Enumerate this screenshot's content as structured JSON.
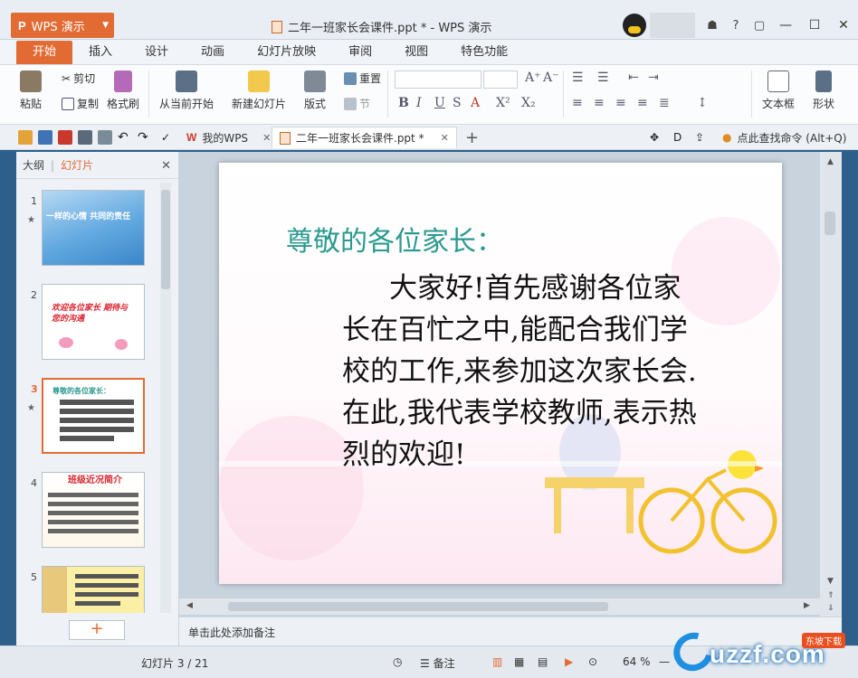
{
  "app": {
    "button_label": "WPS 演示",
    "window_title": "二年一班家长会课件.ppt * - WPS 演示"
  },
  "tabs": [
    "开始",
    "插入",
    "设计",
    "动画",
    "幻灯片放映",
    "审阅",
    "视图",
    "特色功能"
  ],
  "ribbon": {
    "paste": "粘贴",
    "cut": "剪切",
    "copy": "复制",
    "format_painter": "格式刷",
    "from_current": "从当前开始",
    "new_slide": "新建幻灯片",
    "layout": "版式",
    "reset": "重置",
    "section": "节",
    "text_box": "文本框",
    "shape": "形状"
  },
  "quick_bar": {
    "tab1": "我的WPS",
    "tab2": "二年一班家长会课件.ppt *",
    "search": "点此查找命令 (Alt+Q)"
  },
  "left_panel": {
    "tab_outline": "大纲",
    "tab_slides": "幻灯片",
    "thumbnails": [
      {
        "num": "1",
        "text": "一样的心情 共同的责任"
      },
      {
        "num": "2",
        "text": "欢迎各位家长 期待与您的沟通"
      },
      {
        "num": "3",
        "text": "尊敬的各位家长："
      },
      {
        "num": "4",
        "text": "班级近况简介"
      },
      {
        "num": "5",
        "text": ""
      }
    ]
  },
  "slide": {
    "title": "尊敬的各位家长：",
    "body": "大家好!首先感谢各位家长在百忙之中,能配合我们学校的工作,来参加这次家长会.在此,我代表学校教师,表示热烈的欢迎!"
  },
  "notes_placeholder": "单击此处添加备注",
  "status": {
    "slide_counter": "幻灯片 3 / 21",
    "notes": "备注",
    "zoom": "64 %"
  },
  "watermark": {
    "text": "uzzf.com",
    "badge": "东坡下载"
  },
  "colors": {
    "accent": "#e26b34",
    "slide_title": "#2a9a8e"
  }
}
